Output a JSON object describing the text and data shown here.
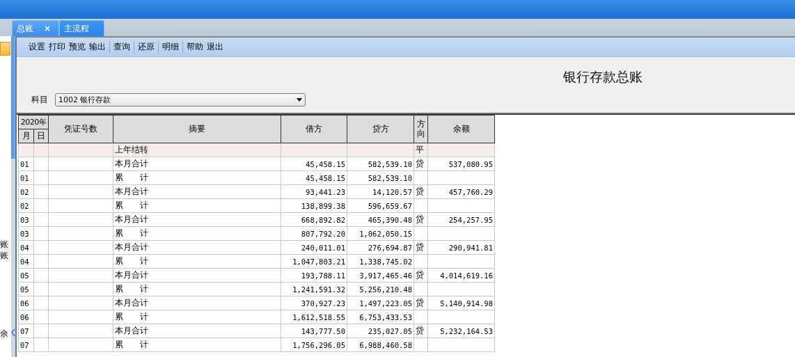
{
  "tabs": [
    {
      "label": "总账",
      "selected": true
    },
    {
      "label": "主流程",
      "selected": false
    }
  ],
  "sidebar": {
    "items": [
      "账",
      "账",
      "余"
    ]
  },
  "toolbar": {
    "groups": [
      [
        "设置",
        "打印",
        "预览",
        "输出"
      ],
      [
        "查询"
      ],
      [
        "还原"
      ],
      [
        "明细"
      ],
      [
        "帮助",
        "退出"
      ]
    ]
  },
  "report": {
    "title": "银行存款总账",
    "subject_label": "科目",
    "subject_value": "1002 银行存款"
  },
  "table": {
    "year": "2020年",
    "columns": {
      "month": "月",
      "day": "日",
      "voucher": "凭证号数",
      "summary": "摘要",
      "debit": "借方",
      "credit": "贷方",
      "direction": "方向",
      "balance": "余额"
    },
    "rows": [
      {
        "summary": "上年结转",
        "direction": "平",
        "highlighted": true
      },
      {
        "month": "01",
        "summary": "本月合计",
        "debit": "45,458.15",
        "credit": "582,539.10",
        "direction": "贷",
        "balance": "537,080.95",
        "highlighted": false
      },
      {
        "month": "01",
        "summary": "累　　计",
        "debit": "45,458.15",
        "credit": "582,539.10",
        "highlighted": false
      },
      {
        "month": "02",
        "summary": "本月合计",
        "debit": "93,441.23",
        "credit": "14,120.57",
        "direction": "贷",
        "balance": "457,760.29",
        "highlighted": false
      },
      {
        "month": "02",
        "summary": "累　　计",
        "debit": "138,899.38",
        "credit": "596,659.67",
        "highlighted": false
      },
      {
        "month": "03",
        "summary": "本月合计",
        "debit": "668,892.82",
        "credit": "465,390.48",
        "direction": "贷",
        "balance": "254,257.95",
        "highlighted": false
      },
      {
        "month": "03",
        "summary": "累　　计",
        "debit": "807,792.20",
        "credit": "1,062,050.15",
        "highlighted": false
      },
      {
        "month": "04",
        "summary": "本月合计",
        "debit": "240,011.01",
        "credit": "276,694.87",
        "direction": "贷",
        "balance": "290,941.81",
        "highlighted": false
      },
      {
        "month": "04",
        "summary": "累　　计",
        "debit": "1,047,803.21",
        "credit": "1,338,745.02",
        "highlighted": false
      },
      {
        "month": "05",
        "summary": "本月合计",
        "debit": "193,788.11",
        "credit": "3,917,465.46",
        "direction": "贷",
        "balance": "4,014,619.16",
        "highlighted": false
      },
      {
        "month": "05",
        "summary": "累　　计",
        "debit": "1,241,591.32",
        "credit": "5,256,210.48",
        "highlighted": false
      },
      {
        "month": "06",
        "summary": "本月合计",
        "debit": "370,927.23",
        "credit": "1,497,223.05",
        "direction": "贷",
        "balance": "5,140,914.98",
        "highlighted": false
      },
      {
        "month": "06",
        "summary": "累　　计",
        "debit": "1,612,518.55",
        "credit": "6,753,433.53",
        "highlighted": false
      },
      {
        "month": "07",
        "summary": "本月合计",
        "debit": "143,777.50",
        "credit": "235,027.05",
        "direction": "贷",
        "balance": "5,232,164.53",
        "highlighted": false
      },
      {
        "month": "07",
        "summary": "累　　计",
        "debit": "1,756,296.05",
        "credit": "6,988,460.58",
        "highlighted": false
      }
    ]
  }
}
